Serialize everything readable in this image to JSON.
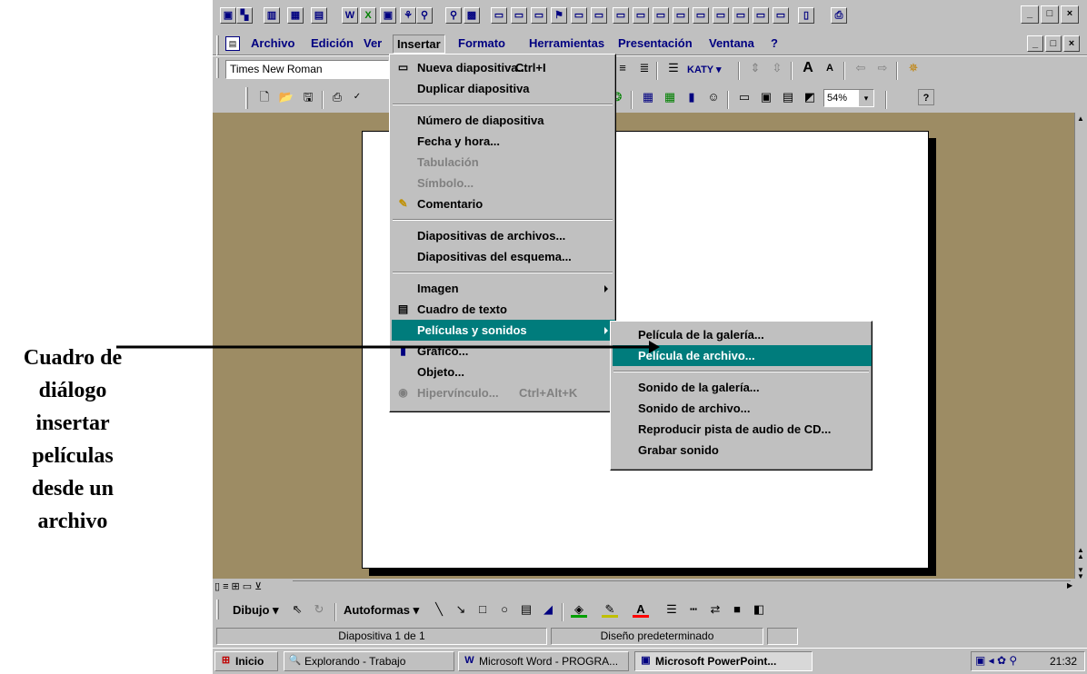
{
  "window": {
    "app_icons": [
      "powerpoint-icon",
      "ribbon-icon",
      "chart-icon",
      "chart2-icon",
      "document-icon",
      "word-icon",
      "excel-icon",
      "powerpoint2-icon",
      "access-icon",
      "binder-icon",
      "search-icon",
      "camera-icon",
      "window-icon",
      "window-icon",
      "window-icon",
      "flag-icon",
      "window-icon",
      "window-icon",
      "window-icon",
      "window-icon",
      "window-icon",
      "window-icon",
      "window-icon",
      "window-icon",
      "window-icon",
      "window-icon",
      "window-icon",
      "book-icon",
      "printer-icon"
    ],
    "controls": [
      "_",
      "□",
      "×"
    ]
  },
  "menubar": {
    "items": [
      "Archivo",
      "Edición",
      "Ver",
      "Insertar",
      "Formato",
      "Herramientas",
      "Presentación",
      "Ventana",
      "?"
    ],
    "active": "Insertar"
  },
  "toolbar": {
    "font_name": "Times New Roman",
    "katy_label": "KATY",
    "zoom": "54%"
  },
  "insert_menu": {
    "items": [
      {
        "label": "Nueva diapositiva...",
        "shortcut": "Ctrl+I",
        "icon": "new-slide-icon",
        "enabled": true
      },
      {
        "label": "Duplicar diapositiva",
        "enabled": true
      },
      {
        "sep": true
      },
      {
        "label": "Número de diapositiva",
        "enabled": true
      },
      {
        "label": "Fecha y hora...",
        "enabled": true
      },
      {
        "label": "Tabulación",
        "enabled": false
      },
      {
        "label": "Símbolo...",
        "enabled": false
      },
      {
        "label": "Comentario",
        "icon": "comment-icon",
        "enabled": true
      },
      {
        "sep": true
      },
      {
        "label": "Diapositivas de archivos...",
        "enabled": true
      },
      {
        "label": "Diapositivas del esquema...",
        "enabled": true
      },
      {
        "sep": true
      },
      {
        "label": "Imagen",
        "submenu": true,
        "enabled": true
      },
      {
        "label": "Cuadro de texto",
        "icon": "textbox-icon",
        "enabled": true
      },
      {
        "label": "Películas y sonidos",
        "submenu": true,
        "enabled": true,
        "highlighted": true
      },
      {
        "label": "Gráfico...",
        "icon": "chart-icon",
        "enabled": true
      },
      {
        "label": "Objeto...",
        "enabled": true
      },
      {
        "label": "Hipervínculo...",
        "shortcut": "Ctrl+Alt+K",
        "icon": "hyperlink-icon",
        "enabled": false
      }
    ]
  },
  "movies_submenu": {
    "items": [
      {
        "label": "Película de la galería...",
        "enabled": true
      },
      {
        "label": "Película de archivo...",
        "enabled": true,
        "highlighted": true
      },
      {
        "sep": true
      },
      {
        "label": "Sonido de la galería...",
        "enabled": true
      },
      {
        "label": "Sonido de archivo...",
        "enabled": true
      },
      {
        "label": "Reproducir pista de audio de CD...",
        "enabled": true
      },
      {
        "label": "Grabar sonido",
        "enabled": true
      }
    ]
  },
  "annotation": {
    "lines": [
      "Cuadro de",
      "diálogo",
      "insertar",
      "películas",
      "desde un",
      "archivo"
    ]
  },
  "drawing_toolbar": {
    "draw_label": "Dibujo",
    "autoshapes_label": "Autoformas"
  },
  "statusbar": {
    "slide_info": "Diapositiva 1 de 1",
    "design": "Diseño predeterminado"
  },
  "taskbar": {
    "start_label": "Inicio",
    "buttons": [
      "Explorando - Trabajo",
      "Microsoft Word - PROGRA...",
      "Microsoft PowerPoint..."
    ],
    "clock": "21:32"
  },
  "colors": {
    "face": "#c0c0c0",
    "workspace": "#9d8c64",
    "highlight": "#007c7c"
  }
}
